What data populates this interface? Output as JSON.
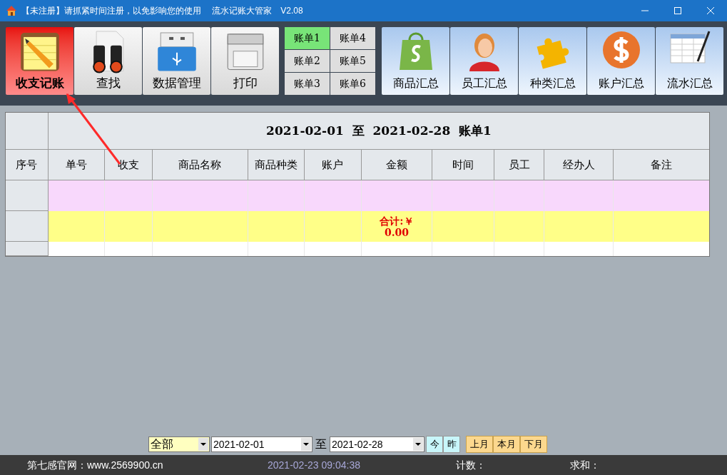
{
  "window": {
    "title": "【未注册】请抓紧时间注册，以免影响您的使用　 流水记账大管家　V2.08"
  },
  "toolbar": [
    {
      "label": "收支记账",
      "selected": true
    },
    {
      "label": "查找",
      "selected": false
    },
    {
      "label": "数据管理",
      "selected": false
    },
    {
      "label": "打印",
      "selected": false
    }
  ],
  "ledgers": [
    {
      "label": "账单1",
      "selected": true
    },
    {
      "label": "账单2",
      "selected": false
    },
    {
      "label": "账单3",
      "selected": false
    },
    {
      "label": "账单4",
      "selected": false
    },
    {
      "label": "账单5",
      "selected": false
    },
    {
      "label": "账单6",
      "selected": false
    }
  ],
  "summaries": [
    {
      "label": "商品汇总"
    },
    {
      "label": "员工汇总"
    },
    {
      "label": "种类汇总"
    },
    {
      "label": "账户汇总"
    },
    {
      "label": "流水汇总"
    }
  ],
  "table": {
    "title": "2021-02-01  至  2021-02-28  账单1",
    "columns": [
      "序号",
      "单号",
      "收支",
      "商品名称",
      "商品种类",
      "账户",
      "金额",
      "时间",
      "员工",
      "经办人",
      "备注"
    ],
    "rows": [
      {
        "kind": "entry"
      },
      {
        "kind": "total",
        "label": "合计:￥",
        "value": "0.00"
      },
      {
        "kind": "blank"
      }
    ]
  },
  "filter": {
    "category": "全部",
    "from": "2021-02-01",
    "to_label": "至",
    "to": "2021-02-28",
    "day_buttons": [
      "今",
      "昨"
    ],
    "month_buttons": [
      "上月",
      "本月",
      "下月"
    ]
  },
  "status_bar": {
    "website": "第七感官网：www.2569900.cn",
    "datetime": "2021-02-23 09:04:38",
    "count_label": "计数：",
    "sum_label": "求和："
  }
}
